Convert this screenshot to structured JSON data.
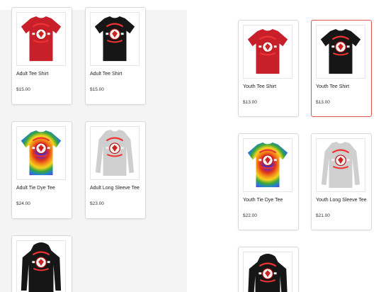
{
  "left_panel": {
    "products": [
      {
        "name": "Adult Tee Shirt",
        "price": "$15.00",
        "icon": "red-tshirt-icon",
        "color": "#c8202a"
      },
      {
        "name": "Adult Tee Shirt",
        "price": "$15.00",
        "icon": "black-tshirt-icon",
        "color": "#161616"
      },
      {
        "name": "Adult Tie Dye Tee",
        "price": "$24.00",
        "icon": "tie-dye-tshirt-icon",
        "color": "#e8402a"
      },
      {
        "name": "Adult Long Sleeve Tee",
        "price": "$23.00",
        "icon": "gray-long-sleeve-icon",
        "color": "#cfcfcf"
      },
      {
        "name": "",
        "price": "",
        "icon": "black-hoodie-icon",
        "color": "#161616"
      }
    ]
  },
  "right_panel": {
    "products": [
      {
        "name": "Youth Tee Shirt",
        "price": "$13.00",
        "icon": "red-tshirt-icon",
        "color": "#c8202a"
      },
      {
        "name": "Youth Tee Shirt",
        "price": "$13.00",
        "icon": "black-tshirt-icon",
        "color": "#161616",
        "selected": true
      },
      {
        "name": "Youth Tie Dye Tee",
        "price": "$22.00",
        "icon": "tie-dye-tshirt-icon",
        "color": "#e8402a"
      },
      {
        "name": "Youth Long Sleeve Tee",
        "price": "$21.00",
        "icon": "gray-long-sleeve-icon",
        "color": "#cfcfcf"
      },
      {
        "name": "",
        "price": "",
        "icon": "black-hoodie-icon",
        "color": "#161616"
      }
    ]
  },
  "colors": {
    "selected_border": "#e3544c",
    "card_border": "#d9d9d9"
  }
}
